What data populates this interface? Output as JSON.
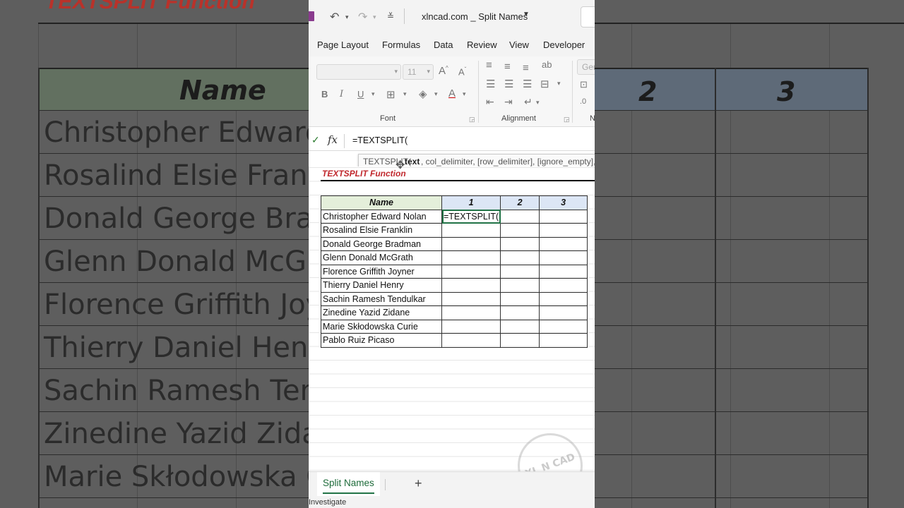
{
  "background": {
    "title": "TEXTSPLIT Function",
    "header_name": "Name",
    "header_nums": [
      "2",
      "3"
    ],
    "names": [
      "Christopher Edward",
      "Rosalind Elsie Frank",
      "Donald George Brad",
      "Glenn Donald McGr",
      "Florence Griffith Joy",
      "Thierry Daniel Henr",
      "Sachin Ramesh Ten",
      "Zinedine Yazid Zidar",
      "Marie Skłodowska C"
    ]
  },
  "titlebar": {
    "document_title": "xlncad.com _  Split Names",
    "undo_icon": "undo-icon",
    "redo_icon": "redo-icon",
    "customize_icon": "customize-quick-access-icon"
  },
  "tabs": [
    "Page Layout",
    "Formulas",
    "Data",
    "Review",
    "View",
    "Developer"
  ],
  "ribbon": {
    "font_size": "11",
    "number_format": "Gen",
    "font_group_label": "Font",
    "alignment_group_label": "Alignment",
    "number_group_label": "N"
  },
  "formula_bar": {
    "fx_label": "fx",
    "formula": "=TEXTSPLIT("
  },
  "tooltip": {
    "fn": "TEXTSPLIT(",
    "arg_bold": "text",
    "rest": ", col_delimiter, [row_delimiter], [ignore_empty],"
  },
  "sheet": {
    "title": "TEXTSPLIT Function",
    "headers": [
      "Name",
      "1",
      "2",
      "3"
    ],
    "rows": [
      [
        "Christopher Edward Nolan",
        "=TEXTSPLIT(",
        "",
        ""
      ],
      [
        "Rosalind Elsie Franklin",
        "",
        "",
        ""
      ],
      [
        "Donald George Bradman",
        "",
        "",
        ""
      ],
      [
        "Glenn Donald McGrath",
        "",
        "",
        ""
      ],
      [
        "Florence Griffith Joyner",
        "",
        "",
        ""
      ],
      [
        "Thierry Daniel Henry",
        "",
        "",
        ""
      ],
      [
        "Sachin Ramesh Tendulkar",
        "",
        "",
        ""
      ],
      [
        "Zinedine Yazid Zidane",
        "",
        "",
        ""
      ],
      [
        "Marie Skłodowska Curie",
        "",
        "",
        ""
      ],
      [
        "Pablo Ruiz Picaso",
        "",
        "",
        ""
      ]
    ],
    "watermark": "XL N CAD"
  },
  "sheet_tabs": {
    "active": "Split Names",
    "add_label": "+"
  },
  "status": {
    "text": "Investigate"
  },
  "colors": {
    "accent": "#217346",
    "title_red": "#c0282d",
    "name_header_bg": "#e4efda",
    "num_header_bg": "#dce6f5"
  }
}
